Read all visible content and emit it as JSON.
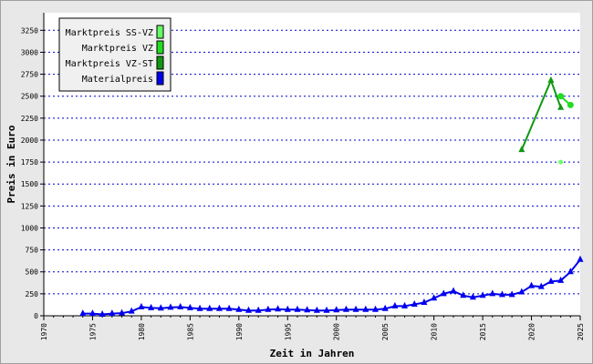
{
  "chart_data": {
    "type": "line",
    "xlabel": "Zeit in Jahren",
    "ylabel": "Preis in Euro",
    "xlim": [
      1970,
      2025
    ],
    "ylim": [
      0,
      3450
    ],
    "x_ticks": [
      1970,
      1975,
      1980,
      1985,
      1990,
      1995,
      2000,
      2005,
      2010,
      2015,
      2020,
      2025
    ],
    "y_ticks": [
      0,
      250,
      500,
      750,
      1000,
      1250,
      1500,
      1750,
      2000,
      2250,
      2500,
      2750,
      3000,
      3250
    ],
    "grid": "horizontal dotted",
    "legend_position": "top-left",
    "series": [
      {
        "name": "Marktpreis SS-VZ",
        "color": "#66ff66",
        "marker": "circle",
        "line": false,
        "points": [
          [
            2023,
            1750
          ]
        ]
      },
      {
        "name": "Marktpreis VZ",
        "color": "#22dd22",
        "marker": "circle",
        "line": true,
        "points": [
          [
            2023,
            2500
          ],
          [
            2024,
            2400
          ]
        ]
      },
      {
        "name": "Marktpreis VZ-ST",
        "color": "#119911",
        "marker": "triangle",
        "line": true,
        "points": [
          [
            2019,
            1890
          ],
          [
            2022,
            2680
          ],
          [
            2023,
            2370
          ]
        ]
      },
      {
        "name": "Materialpreis",
        "color": "#0000ee",
        "marker": "triangle",
        "line": true,
        "points": [
          [
            1974,
            25
          ],
          [
            1975,
            25
          ],
          [
            1976,
            15
          ],
          [
            1977,
            25
          ],
          [
            1978,
            30
          ],
          [
            1979,
            50
          ],
          [
            1980,
            100
          ],
          [
            1981,
            90
          ],
          [
            1982,
            85
          ],
          [
            1983,
            95
          ],
          [
            1984,
            100
          ],
          [
            1985,
            90
          ],
          [
            1986,
            80
          ],
          [
            1987,
            80
          ],
          [
            1988,
            80
          ],
          [
            1989,
            80
          ],
          [
            1990,
            70
          ],
          [
            1991,
            60
          ],
          [
            1992,
            60
          ],
          [
            1993,
            70
          ],
          [
            1994,
            75
          ],
          [
            1995,
            70
          ],
          [
            1996,
            70
          ],
          [
            1997,
            65
          ],
          [
            1998,
            60
          ],
          [
            1999,
            60
          ],
          [
            2000,
            65
          ],
          [
            2001,
            70
          ],
          [
            2002,
            70
          ],
          [
            2003,
            70
          ],
          [
            2004,
            70
          ],
          [
            2005,
            80
          ],
          [
            2006,
            110
          ],
          [
            2007,
            110
          ],
          [
            2008,
            130
          ],
          [
            2009,
            150
          ],
          [
            2010,
            200
          ],
          [
            2011,
            250
          ],
          [
            2012,
            280
          ],
          [
            2013,
            230
          ],
          [
            2014,
            210
          ],
          [
            2015,
            230
          ],
          [
            2016,
            250
          ],
          [
            2017,
            240
          ],
          [
            2018,
            240
          ],
          [
            2019,
            270
          ],
          [
            2020,
            340
          ],
          [
            2021,
            330
          ],
          [
            2022,
            390
          ],
          [
            2023,
            400
          ],
          [
            2024,
            500
          ],
          [
            2025,
            640
          ]
        ]
      }
    ]
  }
}
